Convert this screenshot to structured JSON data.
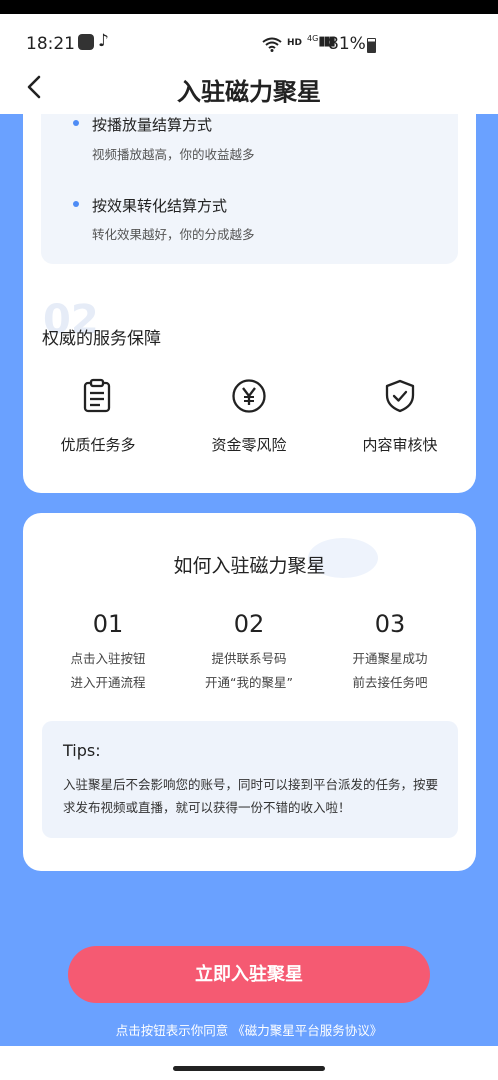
{
  "status_bar": {
    "time": "18:21",
    "hd": "HD",
    "signal": "4G",
    "battery_text": "81%"
  },
  "header": {
    "title": "入驻磁力聚星"
  },
  "settlement": {
    "items": [
      {
        "title": "按播放量结算方式",
        "desc": "视频播放越高，你的收益越多"
      },
      {
        "title": "按效果转化结算方式",
        "desc": "转化效果越好，你的分成越多"
      }
    ]
  },
  "guarantee": {
    "watermark": "02",
    "title": "权威的服务保障",
    "features": [
      {
        "icon": "clipboard-icon",
        "label": "优质任务多"
      },
      {
        "icon": "yuan-icon",
        "label": "资金零风险"
      },
      {
        "icon": "shield-check-icon",
        "label": "内容审核快"
      }
    ]
  },
  "how_to": {
    "title": "如何入驻磁力聚星",
    "steps": [
      {
        "num": "01",
        "line1": "点击入驻按钮",
        "line2": "进入开通流程"
      },
      {
        "num": "02",
        "line1": "提供联系号码",
        "line2": "开通“我的聚星”"
      },
      {
        "num": "03",
        "line1": "开通聚星成功",
        "line2": "前去接任务吧"
      }
    ],
    "tips_title": "Tips:",
    "tips_body": "入驻聚星后不会影响您的账号，同时可以接到平台派发的任务，按要求发布视频或直播，就可以获得一份不错的收入啦！"
  },
  "cta": {
    "label": "立即入驻聚星"
  },
  "agreement": {
    "text": "点击按钮表示你同意 《磁力聚星平台服务协议》"
  },
  "colors": {
    "background": "#6aa1ff",
    "accent": "#f55a72",
    "bullet": "#4e8cf5"
  }
}
